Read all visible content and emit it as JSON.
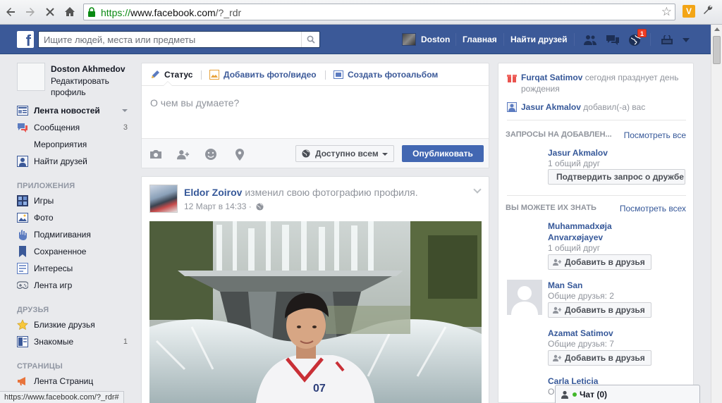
{
  "browser": {
    "url_scheme": "https://",
    "url_host": "www.facebook.com",
    "url_path": "/?_rdr",
    "status_url": "https://www.facebook.com/?_rdr#"
  },
  "topbar": {
    "logo": "f",
    "search_placeholder": "Ищите людей, места или предметы",
    "user_name": "Doston",
    "home": "Главная",
    "find_friends": "Найти друзей",
    "notif_count": "1"
  },
  "left": {
    "name": "Doston Akhmedov",
    "edit": "Редактировать профиль",
    "main": [
      {
        "label": "Лента новостей",
        "count": ""
      },
      {
        "label": "Сообщения",
        "count": "3"
      },
      {
        "label": "Мероприятия",
        "count": ""
      },
      {
        "label": "Найти друзей",
        "count": ""
      }
    ],
    "apps_head": "ПРИЛОЖЕНИЯ",
    "apps": [
      {
        "label": "Игры"
      },
      {
        "label": "Фото"
      },
      {
        "label": "Подмигивания"
      },
      {
        "label": "Сохраненное"
      },
      {
        "label": "Интересы"
      },
      {
        "label": "Лента игр"
      }
    ],
    "friends_head": "ДРУЗЬЯ",
    "friends": [
      {
        "label": "Близкие друзья",
        "count": ""
      },
      {
        "label": "Знакомые",
        "count": "1"
      }
    ],
    "pages_head": "СТРАНИЦЫ",
    "pages": [
      {
        "label": "Лента Страниц"
      }
    ]
  },
  "composer": {
    "tab_status": "Статус",
    "tab_photo": "Добавить фото/видео",
    "tab_album": "Создать фотоальбом",
    "placeholder": "О чем вы думаете?",
    "audience": "Доступно всем",
    "publish": "Опубликовать"
  },
  "post": {
    "author": "Eldor Zoirov",
    "action": "изменил свою фотографию профиля.",
    "time": "12 Март в 14:33 ·"
  },
  "right": {
    "bday_name": "Furqat Satimov",
    "bday_text": "сегодня празднует день рождения",
    "added_name": "Jasur Akmalov",
    "added_text": "добавил(-а) вас",
    "requests_head": "ЗАПРОСЫ НА ДОБАВЛЕН...",
    "requests_see": "Посмотреть все",
    "request": {
      "name": "Jasur Akmalov",
      "sub": "1 общий друг",
      "btn": "Подтвердить запрос о дружбе"
    },
    "pymk_head": "ВЫ МОЖЕТЕ ИХ ЗНАТЬ",
    "pymk_see": "Посмотреть всех",
    "people": [
      {
        "name": "Muhammadxøja Anvarxøjayev",
        "sub": "1 общий друг",
        "btn": "Добавить в друзья"
      },
      {
        "name": "Man San",
        "sub": "Общие друзья: 2",
        "btn": "Добавить в друзья"
      },
      {
        "name": "Azamat Satimov",
        "sub": "Общие друзья: 7",
        "btn": "Добавить в друзья"
      },
      {
        "name": "Carla Leticia",
        "sub": "О",
        "btn": ""
      }
    ]
  },
  "chat": {
    "label": "Чат (0)"
  }
}
